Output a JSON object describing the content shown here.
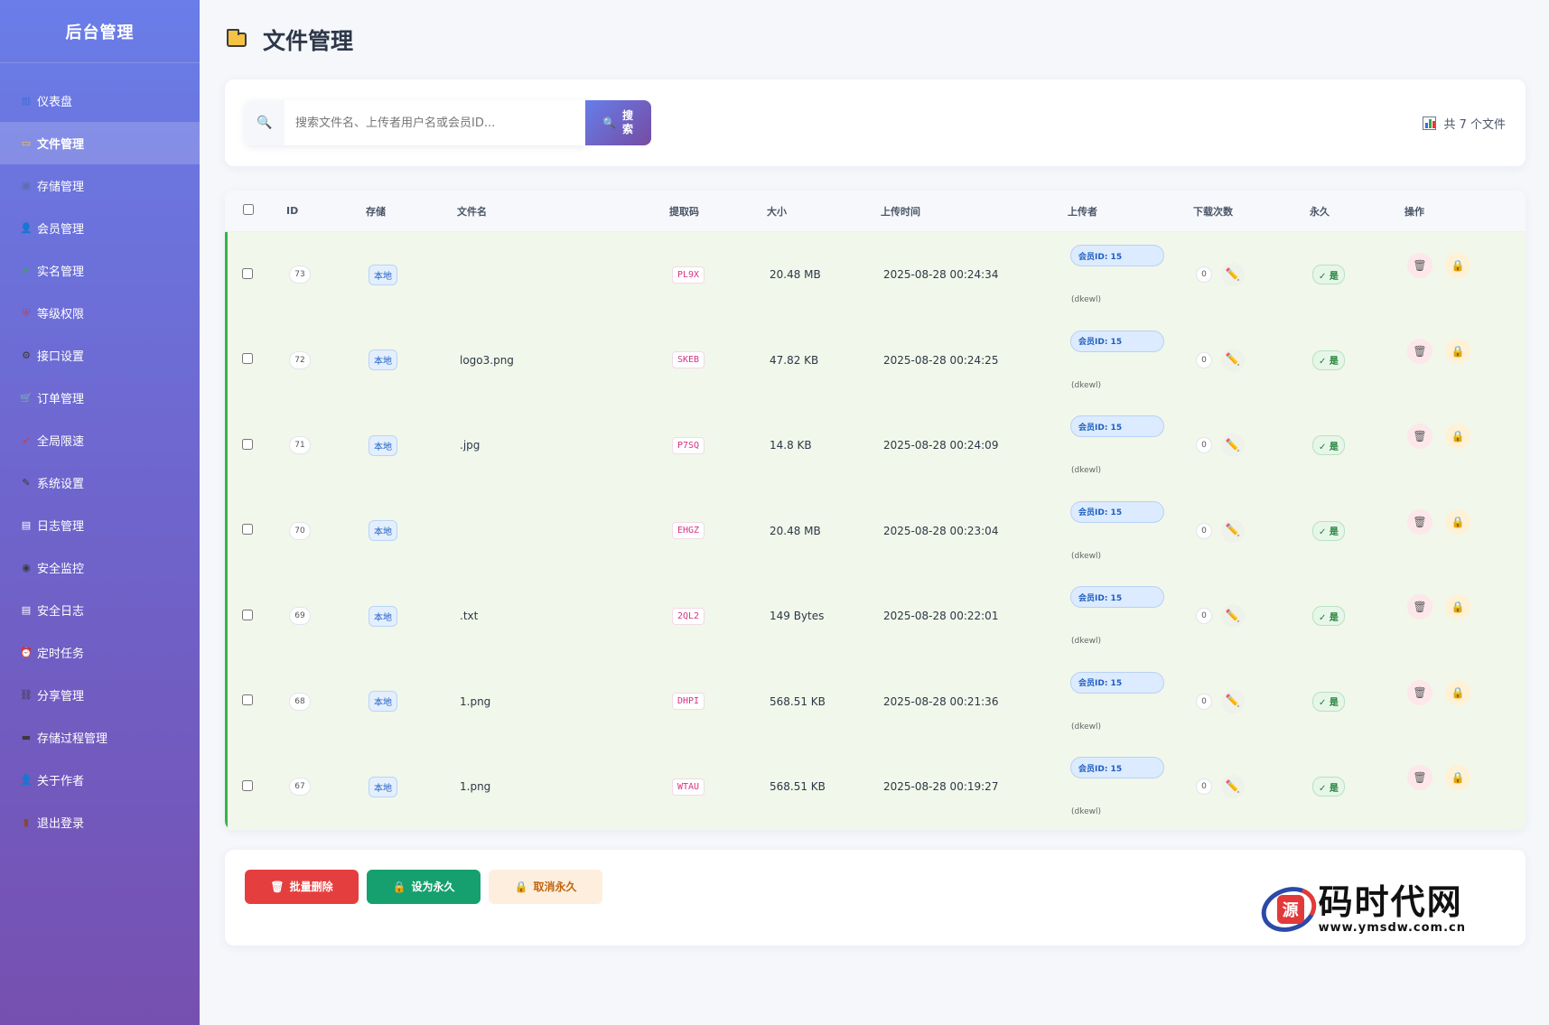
{
  "brand": "后台管理",
  "sidebar": {
    "items": [
      {
        "label": "仪表盘",
        "icon": "bar-chart-icon",
        "glyph": "▥",
        "color": "#3b6fd8",
        "active": false
      },
      {
        "label": "文件管理",
        "icon": "folder-icon",
        "glyph": "▭",
        "color": "#f6c244",
        "active": true
      },
      {
        "label": "存储管理",
        "icon": "floppy-disk-icon",
        "glyph": "▣",
        "color": "#5a6fb0",
        "active": false
      },
      {
        "label": "会员管理",
        "icon": "users-icon",
        "glyph": "👤",
        "color": "#3a3a3a",
        "active": false
      },
      {
        "label": "实名管理",
        "icon": "check-box-icon",
        "glyph": "✔",
        "color": "#2fa84f",
        "active": false
      },
      {
        "label": "等级权限",
        "icon": "shield-icon",
        "glyph": "⛨",
        "color": "#d23b3b",
        "active": false
      },
      {
        "label": "接口设置",
        "icon": "gear-icon",
        "glyph": "⚙",
        "color": "#3a3a3a",
        "active": false
      },
      {
        "label": "订单管理",
        "icon": "cart-icon",
        "glyph": "🛒",
        "color": "#3a3a3a",
        "active": false
      },
      {
        "label": "全局限速",
        "icon": "rocket-icon",
        "glyph": "➶",
        "color": "#d23b3b",
        "active": false
      },
      {
        "label": "系统设置",
        "icon": "wrench-icon",
        "glyph": "✎",
        "color": "#3a3a3a",
        "active": false
      },
      {
        "label": "日志管理",
        "icon": "document-icon",
        "glyph": "▤",
        "color": "#ffffff",
        "active": false
      },
      {
        "label": "安全监控",
        "icon": "eye-icon",
        "glyph": "◉",
        "color": "#3a3a3a",
        "active": false
      },
      {
        "label": "安全日志",
        "icon": "log-document-icon",
        "glyph": "▤",
        "color": "#ffffff",
        "active": false
      },
      {
        "label": "定时任务",
        "icon": "alarm-clock-icon",
        "glyph": "⏰",
        "color": "#d23b3b",
        "active": false
      },
      {
        "label": "分享管理",
        "icon": "link-icon",
        "glyph": "⛓",
        "color": "#3a3a3a",
        "active": false
      },
      {
        "label": "存储过程管理",
        "icon": "laptop-icon",
        "glyph": "▬",
        "color": "#3a3a3a",
        "active": false
      },
      {
        "label": "关于作者",
        "icon": "person-icon",
        "glyph": "👤",
        "color": "#3a3a3a",
        "active": false
      },
      {
        "label": "退出登录",
        "icon": "door-icon",
        "glyph": "▮",
        "color": "#8a4a2a",
        "active": false
      }
    ]
  },
  "page": {
    "title": "文件管理",
    "title_icon": "folder-icon"
  },
  "search": {
    "placeholder": "搜索文件名、上传者用户名或会员ID...",
    "value": "",
    "button_label": "搜索",
    "lead_icon": "magnifier-icon"
  },
  "file_count": "共 7 个文件",
  "table": {
    "headers": [
      "ID",
      "存储",
      "文件名",
      "提取码",
      "大小",
      "上传时间",
      "上传者",
      "下载次数",
      "永久",
      "操作"
    ],
    "rows": [
      {
        "id": "73",
        "storage": "本地",
        "filename": "",
        "code": "PL9X",
        "size": "20.48 MB",
        "time": "2025-08-28 00:24:34",
        "member": "会员ID: 15",
        "user": "(dkewl)",
        "downloads": "0",
        "permanent": "✓ 是"
      },
      {
        "id": "72",
        "storage": "本地",
        "filename": "logo3.png",
        "code": "SKEB",
        "size": "47.82 KB",
        "time": "2025-08-28 00:24:25",
        "member": "会员ID: 15",
        "user": "(dkewl)",
        "downloads": "0",
        "permanent": "✓ 是"
      },
      {
        "id": "71",
        "storage": "本地",
        "filename": ".jpg",
        "code": "P7SQ",
        "size": "14.8 KB",
        "time": "2025-08-28 00:24:09",
        "member": "会员ID: 15",
        "user": "(dkewl)",
        "downloads": "0",
        "permanent": "✓ 是"
      },
      {
        "id": "70",
        "storage": "本地",
        "filename": "",
        "code": "EHGZ",
        "size": "20.48 MB",
        "time": "2025-08-28 00:23:04",
        "member": "会员ID: 15",
        "user": "(dkewl)",
        "downloads": "0",
        "permanent": "✓ 是"
      },
      {
        "id": "69",
        "storage": "本地",
        "filename": ".txt",
        "code": "2QL2",
        "size": "149 Bytes",
        "time": "2025-08-28 00:22:01",
        "member": "会员ID: 15",
        "user": "(dkewl)",
        "downloads": "0",
        "permanent": "✓ 是"
      },
      {
        "id": "68",
        "storage": "本地",
        "filename": "1.png",
        "code": "DHPI",
        "size": "568.51 KB",
        "time": "2025-08-28 00:21:36",
        "member": "会员ID: 15",
        "user": "(dkewl)",
        "downloads": "0",
        "permanent": "✓ 是"
      },
      {
        "id": "67",
        "storage": "本地",
        "filename": "1.png",
        "code": "WTAU",
        "size": "568.51 KB",
        "time": "2025-08-28 00:19:27",
        "member": "会员ID: 15",
        "user": "(dkewl)",
        "downloads": "0",
        "permanent": "✓ 是"
      }
    ]
  },
  "bulk": {
    "delete_label": "批量删除",
    "set_permanent_label": "设为永久",
    "cancel_permanent_label": "取消永久"
  },
  "watermark": {
    "text": "码时代网",
    "url": "www.ymsdw.com.cn",
    "logo_char": "源"
  },
  "colors": {
    "accent": "#667eea",
    "accent2": "#764ba2",
    "row_bg": "#f1f7ea",
    "row_border": "#35b34a",
    "danger": "#e53e3e",
    "success": "#16a070"
  }
}
